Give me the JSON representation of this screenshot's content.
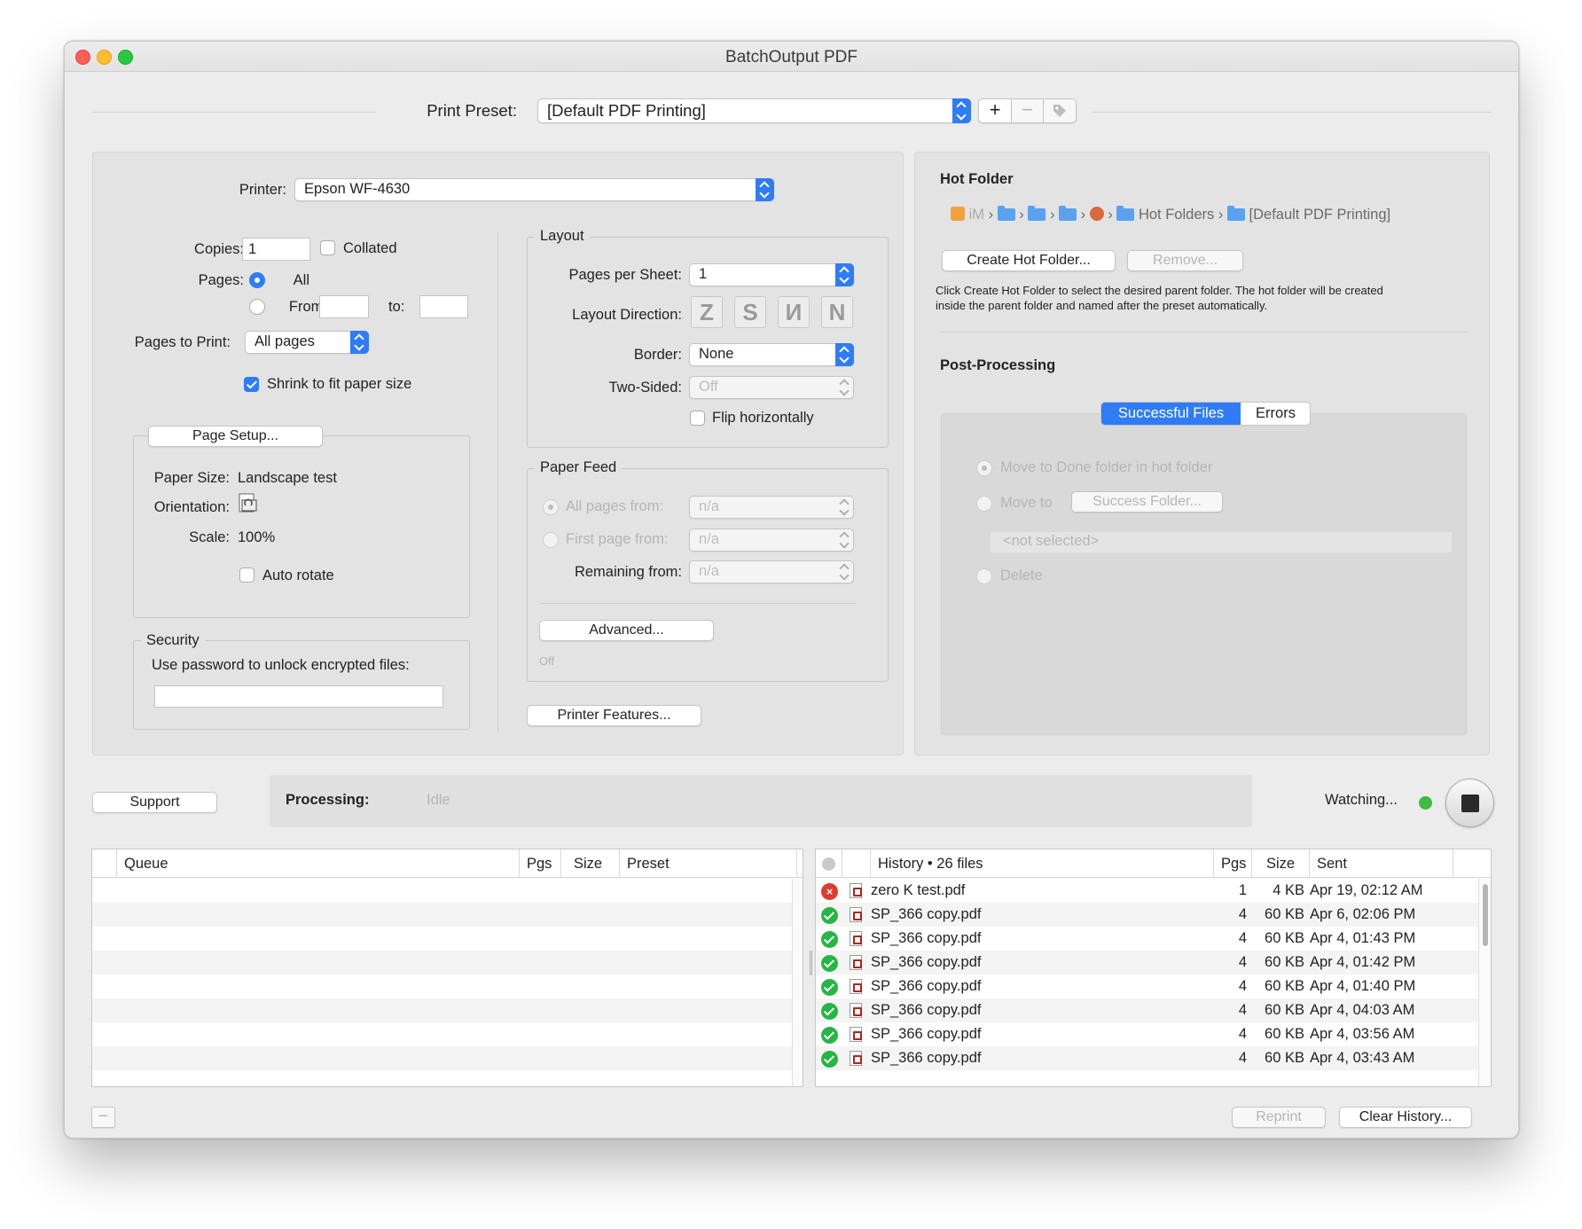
{
  "window": {
    "title": "BatchOutput PDF"
  },
  "preset": {
    "label": "Print Preset:",
    "value": "[Default PDF Printing]",
    "add": "+",
    "remove": "−"
  },
  "printer": {
    "label": "Printer:",
    "value": "Epson WF-4630"
  },
  "copies": {
    "label": "Copies:",
    "value": "1",
    "collated": "Collated"
  },
  "pages": {
    "label": "Pages:",
    "all": "All",
    "from": "From:",
    "to": "to:"
  },
  "pages_to_print": {
    "label": "Pages to Print:",
    "value": "All pages"
  },
  "shrink": {
    "label": "Shrink to fit paper size",
    "checked": true
  },
  "page_setup": {
    "button": "Page Setup...",
    "paper_size_label": "Paper Size:",
    "paper_size": "Landscape test",
    "orientation_label": "Orientation:",
    "scale_label": "Scale:",
    "scale": "100%",
    "auto_rotate": "Auto rotate"
  },
  "security": {
    "title": "Security",
    "label": "Use password to unlock encrypted files:"
  },
  "layout": {
    "title": "Layout",
    "pages_per_sheet_label": "Pages per Sheet:",
    "pages_per_sheet": "1",
    "direction_label": "Layout Direction:",
    "direction_icons": [
      "Z",
      "S",
      "И",
      "N"
    ],
    "border_label": "Border:",
    "border": "None",
    "two_sided_label": "Two-Sided:",
    "two_sided": "Off",
    "flip": "Flip horizontally"
  },
  "paper_feed": {
    "title": "Paper Feed",
    "all_pages": "All pages from:",
    "all_pages_value": "n/a",
    "first_page": "First page from:",
    "first_page_value": "n/a",
    "remaining": "Remaining from:",
    "remaining_value": "n/a",
    "advanced": "Advanced...",
    "advanced_status": "Off"
  },
  "printer_features": "Printer Features...",
  "hot_folder": {
    "title": "Hot Folder",
    "path": [
      "iM",
      "Hot Folders",
      "[Default PDF Printing]"
    ],
    "create": "Create Hot Folder...",
    "remove": "Remove...",
    "help": "Click Create Hot Folder to select the desired parent folder. The hot folder will be created inside the parent folder and named after the preset automatically."
  },
  "post_processing": {
    "title": "Post-Processing",
    "tabs": [
      "Successful Files",
      "Errors"
    ],
    "move_done": "Move to Done folder in hot folder",
    "move_to": "Move to",
    "success_folder": "Success Folder...",
    "not_selected": "<not selected>",
    "delete": "Delete"
  },
  "status": {
    "support": "Support",
    "processing_label": "Processing:",
    "processing_value": "Idle",
    "watching": "Watching..."
  },
  "queue": {
    "columns": [
      "Queue",
      "Pgs",
      "Size",
      "Preset"
    ]
  },
  "history": {
    "columns": [
      "History • 26 files",
      "Pgs",
      "Size",
      "Sent"
    ],
    "rows": [
      {
        "status": "error",
        "name": "zero K test.pdf",
        "pgs": "1",
        "size": "4 KB",
        "sent": "Apr 19, 02:12 AM"
      },
      {
        "status": "ok",
        "name": "SP_366 copy.pdf",
        "pgs": "4",
        "size": "60 KB",
        "sent": "Apr 6, 02:06 PM"
      },
      {
        "status": "ok",
        "name": "SP_366 copy.pdf",
        "pgs": "4",
        "size": "60 KB",
        "sent": "Apr 4, 01:43 PM"
      },
      {
        "status": "ok",
        "name": "SP_366 copy.pdf",
        "pgs": "4",
        "size": "60 KB",
        "sent": "Apr 4, 01:42 PM"
      },
      {
        "status": "ok",
        "name": "SP_366 copy.pdf",
        "pgs": "4",
        "size": "60 KB",
        "sent": "Apr 4, 01:40 PM"
      },
      {
        "status": "ok",
        "name": "SP_366 copy.pdf",
        "pgs": "4",
        "size": "60 KB",
        "sent": "Apr 4, 04:03 AM"
      },
      {
        "status": "ok",
        "name": "SP_366 copy.pdf",
        "pgs": "4",
        "size": "60 KB",
        "sent": "Apr 4, 03:56 AM"
      },
      {
        "status": "ok",
        "name": "SP_366 copy.pdf",
        "pgs": "4",
        "size": "60 KB",
        "sent": "Apr 4, 03:43 AM"
      }
    ]
  },
  "footer": {
    "reprint": "Reprint",
    "clear_history": "Clear History...",
    "minus": "−"
  },
  "colors": {
    "accent": "#2f7cf6",
    "ok": "#28b446",
    "error": "#e03a2c"
  }
}
